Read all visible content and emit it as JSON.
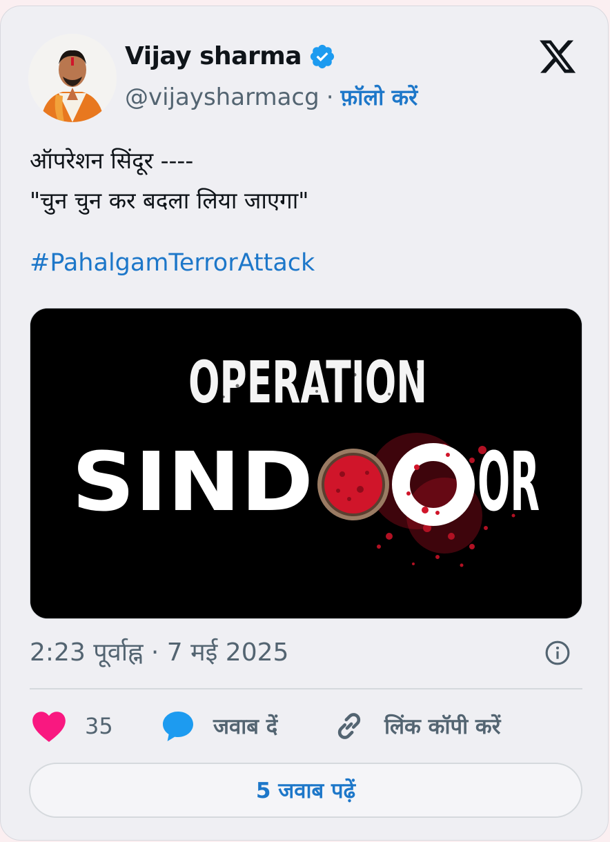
{
  "user": {
    "name": "Vijay sharma",
    "handle": "@vijaysharmacg",
    "separator": "·",
    "follow_label": "फ़ॉलो करें"
  },
  "tweet": {
    "lines": [
      "ऑपरेशन सिंदूर ----",
      "\"चुन चुन कर बदला लिया जाएगा\""
    ],
    "hashtag": "#PahalgamTerrorAttack",
    "image": {
      "line1": "OPERATION",
      "line2_left": "SIND",
      "line2_right": "OR"
    },
    "timestamp": "2:23 पूर्वाह्न · 7 मई 2025"
  },
  "actions": {
    "like_count": "35",
    "reply_label": "जवाब दें",
    "copy_link_label": "लिंक कॉपी करें"
  },
  "read_replies_label": "5 जवाब पढ़ें",
  "colors": {
    "accent": "#1d77c9",
    "verified": "#1d9bf0",
    "like": "#f91880",
    "reply": "#1d9bf0",
    "sindoor_red": "#d0152a"
  },
  "icons": {
    "verified": "verified-badge-icon",
    "logo": "x-logo-icon",
    "info": "info-icon",
    "like": "heart-icon",
    "reply": "speech-bubble-icon",
    "link": "link-icon"
  }
}
